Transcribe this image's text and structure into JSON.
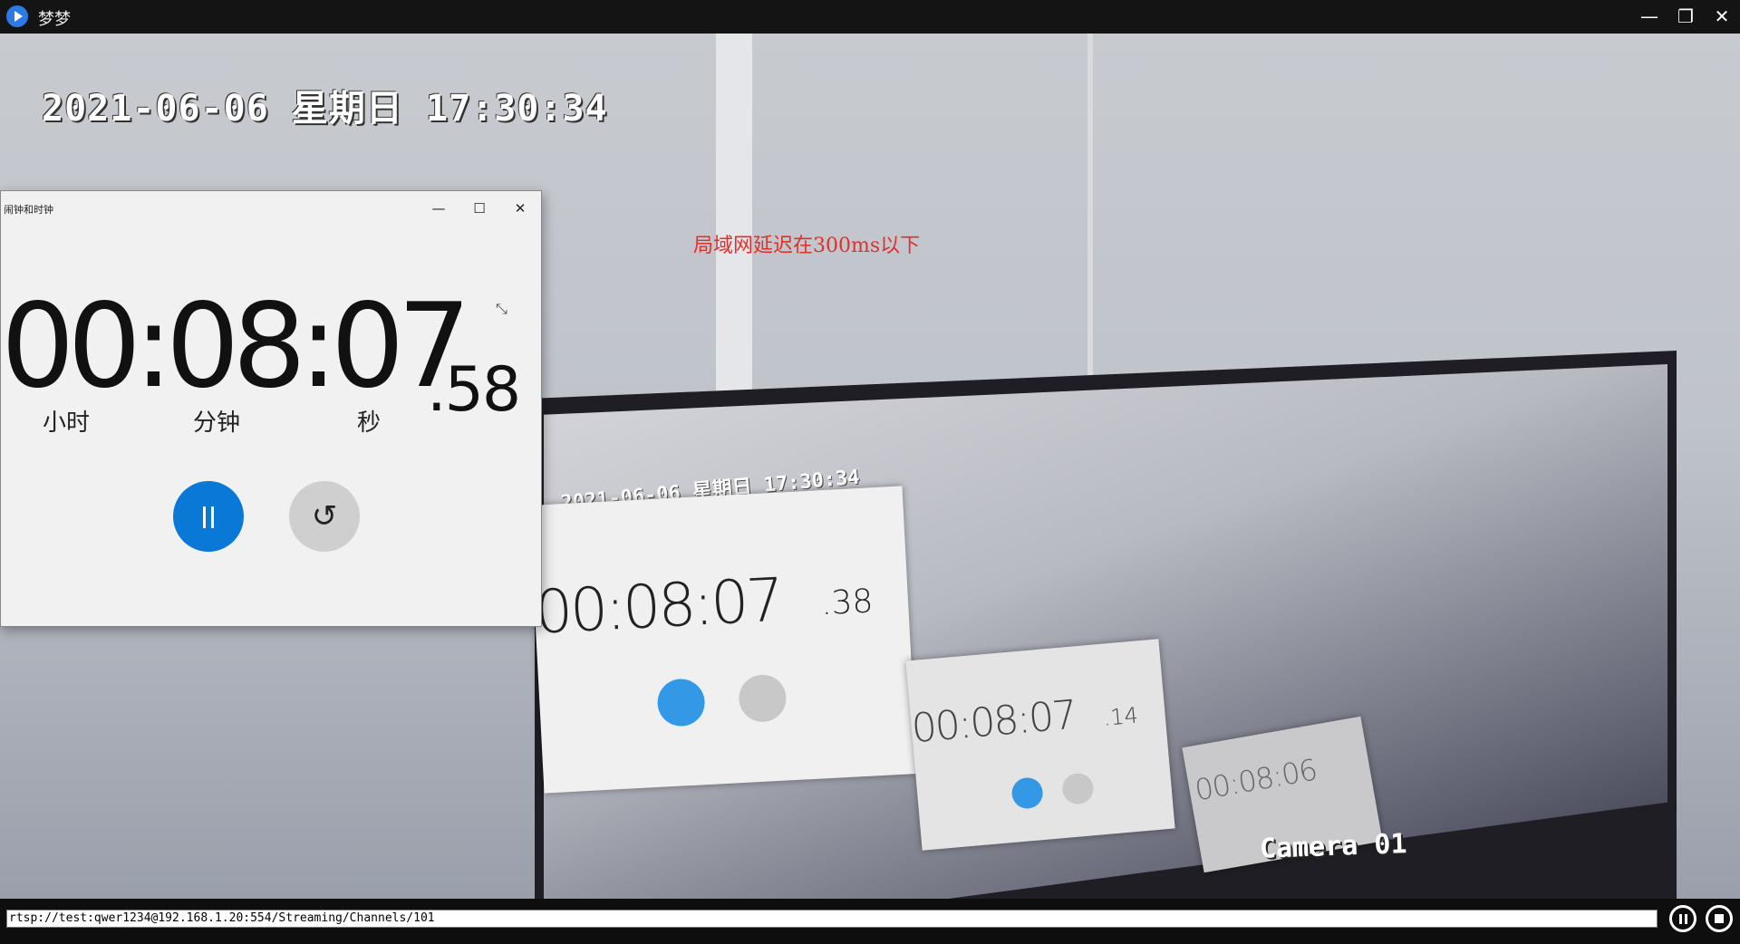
{
  "titlebar": {
    "title": "梦梦",
    "minimize_icon": "—",
    "maximize_icon": "❐",
    "close_icon": "✕"
  },
  "video": {
    "osd_datetime": "2021-06-06 星期日 17:30:34",
    "latency_note": "局域网延迟在300ms以下",
    "nested_datetime": "2021-06-06 星期日 17:30:34",
    "nested_digits_1": "00:08:07",
    "nested_frac_1": ".38",
    "nested_digits_2": "00:08:07",
    "nested_frac_2": ".14",
    "nested_digits_3": "00:08:06",
    "camera_label": "Camera 01"
  },
  "stopwatch": {
    "title": "闹钟和时钟",
    "time": "00:08:07",
    "fraction": ".58",
    "unit_hours": "小时",
    "unit_minutes": "分钟",
    "unit_seconds": "秒",
    "minimize_icon": "—",
    "maximize_icon": "☐",
    "close_icon": "✕",
    "compact_icon": "⤡",
    "reset_icon": "↺"
  },
  "bottombar": {
    "url": "rtsp://test:qwer1234@192.168.1.20:554/Streaming/Channels/101"
  }
}
